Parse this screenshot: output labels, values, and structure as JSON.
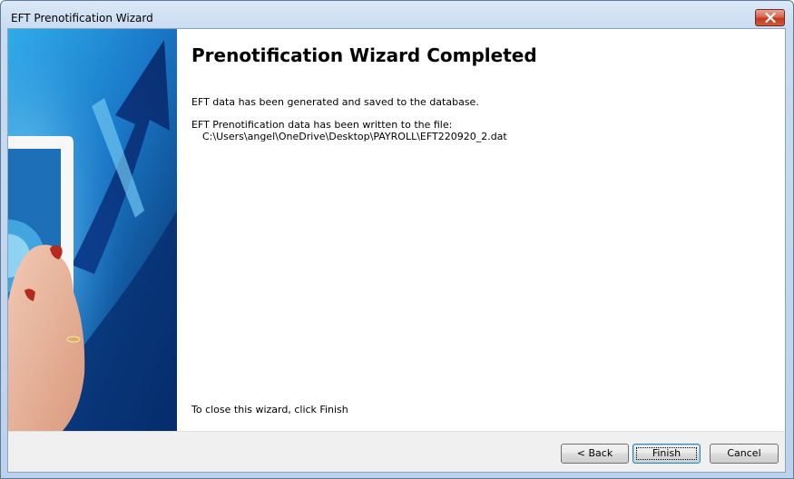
{
  "window": {
    "title": "EFT Prenotification Wizard",
    "close_icon": "close-icon"
  },
  "content": {
    "heading": "Prenotification Wizard Completed",
    "message_saved": "EFT data has been generated and saved to the database.",
    "message_written": "EFT Prenotification data has been written to the file:",
    "file_path": "C:\\Users\\angel\\OneDrive\\Desktop\\PAYROLL\\EFT220920_2.dat",
    "closing_hint": "To close this wizard, click Finish"
  },
  "buttons": {
    "back_label": "< Back",
    "finish_label": "Finish",
    "cancel_label": "Cancel"
  },
  "colors": {
    "banner_blue": "#0a3d8a",
    "accent_cyan": "#3fb8ef",
    "title_bar": "#c9dcf1"
  }
}
